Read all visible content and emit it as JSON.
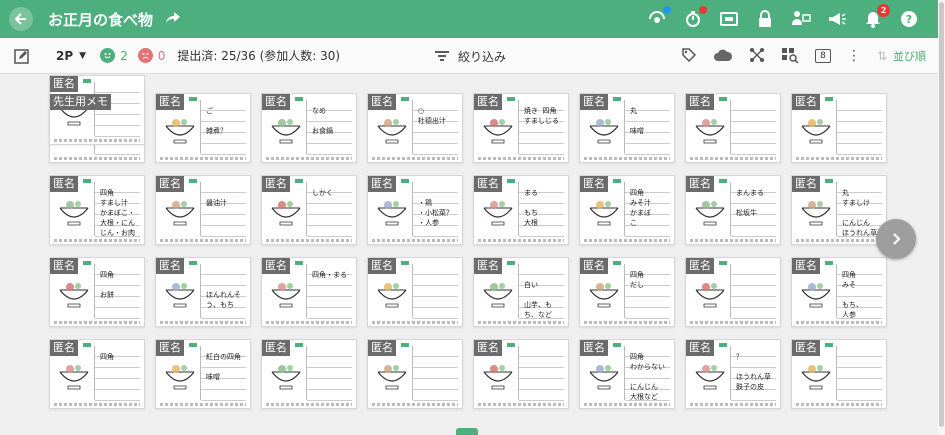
{
  "header": {
    "title": "お正月の食べ物",
    "notification_count": "2",
    "colors": {
      "bar": "#4caf7d"
    }
  },
  "toolbar": {
    "page_mode": "2P",
    "good_count": "2",
    "bad_count": "0",
    "submitted": "提出済: 25/36 (参加人数: 30)",
    "filter_label": "絞り込み",
    "sort_label": "並び順",
    "grid_button": "8"
  },
  "cards": [
    {
      "tag": "先生用メモ",
      "memo": ""
    },
    {
      "tag": "匿名",
      "memo": "ご\n\n雑煮？"
    },
    {
      "tag": "匿名",
      "memo": "なめ\n\nお食鍋"
    },
    {
      "tag": "匿名",
      "memo": "○\n杜德出汁"
    },
    {
      "tag": "匿名",
      "memo": "焼き  四角\nすましじる"
    },
    {
      "tag": "匿名",
      "memo": "丸\n\n味噌"
    },
    {
      "tag": "匿名",
      "memo": ""
    },
    {
      "tag": "匿名",
      "memo": ""
    },
    {
      "tag": "匿名",
      "memo": "四角\nすまし汁\nかまぼこ・\n大根・にん\nじん・お肉"
    },
    {
      "tag": "匿名",
      "memo": "\n醤油汁"
    },
    {
      "tag": "匿名",
      "memo": "しかく"
    },
    {
      "tag": "匿名",
      "memo": "\n・鶏\n・小松菜？\n・人参"
    },
    {
      "tag": "匿名",
      "memo": "まる\n\nもち\n大根"
    },
    {
      "tag": "匿名",
      "memo": "四角\nみそ汁\nかまぼ\nこ"
    },
    {
      "tag": "匿名",
      "memo": "まんまる\n\n松坂牛"
    },
    {
      "tag": "匿名",
      "memo": "丸\nすましけ\n\nにんじん\nほうれん草"
    },
    {
      "tag": "匿名",
      "memo": "四角\n\nお餅"
    },
    {
      "tag": "匿名",
      "memo": "\n\nほんれんそ\nう、もち"
    },
    {
      "tag": "匿名",
      "memo": "四角・まる"
    },
    {
      "tag": "匿名",
      "memo": ""
    },
    {
      "tag": "匿名",
      "memo": "\n白い\n\n山芋、も\nち、など"
    },
    {
      "tag": "匿名",
      "memo": "四角\nだし"
    },
    {
      "tag": "匿名",
      "memo": ""
    },
    {
      "tag": "匿名",
      "memo": "四角\nみそ\n\nもち、\n人参"
    },
    {
      "tag": "匿名",
      "memo": "四角"
    },
    {
      "tag": "匿名",
      "memo": "紅白の四角\n\n味噌"
    },
    {
      "tag": "匿名",
      "memo": ""
    },
    {
      "tag": "匿名",
      "memo": ""
    },
    {
      "tag": "匿名",
      "memo": ""
    },
    {
      "tag": "匿名",
      "memo": "四角\nわからない\n\nにんじん\n大根など"
    },
    {
      "tag": "匿名",
      "memo": "？\n\nほうれん草\n麩子の皮"
    },
    {
      "tag": "匿名",
      "memo": ""
    },
    {
      "tag": "匿名",
      "memo": ""
    }
  ]
}
